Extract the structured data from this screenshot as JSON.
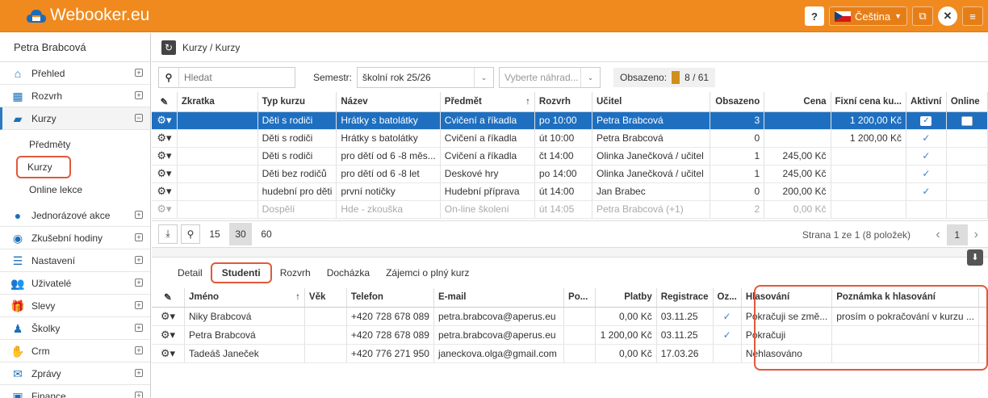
{
  "app": {
    "title": "Webooker.eu",
    "language": "Čeština"
  },
  "sidebar": {
    "user": "Petra Brabcová",
    "items": [
      {
        "label": "Přehled",
        "icon": "home-icon"
      },
      {
        "label": "Rozvrh",
        "icon": "calendar-icon"
      },
      {
        "label": "Kurzy",
        "icon": "book-icon"
      },
      {
        "label": "Jednorázové akce",
        "icon": "ball-icon"
      },
      {
        "label": "Zkušební hodiny",
        "icon": "eye-icon"
      },
      {
        "label": "Nastavení",
        "icon": "settings-icon"
      },
      {
        "label": "Uživatelé",
        "icon": "users-icon"
      },
      {
        "label": "Slevy",
        "icon": "gift-icon"
      },
      {
        "label": "Školky",
        "icon": "child-icon"
      },
      {
        "label": "Crm",
        "icon": "handshake-icon"
      },
      {
        "label": "Zprávy",
        "icon": "mail-icon"
      },
      {
        "label": "Finance",
        "icon": "money-icon"
      }
    ],
    "subitems": [
      "Předměty",
      "Kurzy",
      "Online lekce"
    ]
  },
  "breadcrumb": "Kurzy / Kurzy",
  "filter": {
    "search_placeholder": "Hledat",
    "semester_label": "Semestr:",
    "semester_value": "školní rok 25/26",
    "substitute_placeholder": "Vyberte náhrad...",
    "occupied_label": "Obsazeno:",
    "occupied_value": "8 / 61"
  },
  "courses": {
    "headers": [
      "Zkratka",
      "Typ kurzu",
      "Název",
      "Předmět",
      "Rozvrh",
      "Učitel",
      "Obsazeno",
      "Cena",
      "Fixní cena ku...",
      "Aktivní",
      "Online"
    ],
    "rows": [
      {
        "zkratka": "",
        "typ": "Děti s rodiči",
        "nazev": "Hrátky s batolátky",
        "predmet": "Cvičení a říkadla",
        "rozvrh": "po 10:00",
        "ucitel": "Petra Brabcová",
        "obsazeno": "3",
        "cena": "",
        "fixni": "1 200,00 Kč"
      },
      {
        "zkratka": "",
        "typ": "Děti s rodiči",
        "nazev": "Hrátky s batolátky",
        "predmet": "Cvičení a říkadla",
        "rozvrh": "út 10:00",
        "ucitel": "Petra Brabcová",
        "obsazeno": "0",
        "cena": "",
        "fixni": "1 200,00 Kč"
      },
      {
        "zkratka": "",
        "typ": "Děti s rodiči",
        "nazev": "pro dětí od 6 -8 měs...",
        "predmet": "Cvičení a říkadla",
        "rozvrh": "čt 14:00",
        "ucitel": "Olinka Janečková / učitel",
        "obsazeno": "1",
        "cena": "245,00 Kč",
        "fixni": ""
      },
      {
        "zkratka": "",
        "typ": "Děti bez rodičů",
        "nazev": "pro dětí od 6 -8 let",
        "predmet": "Deskové hry",
        "rozvrh": "po 14:00",
        "ucitel": "Olinka Janečková / učitel",
        "obsazeno": "1",
        "cena": "245,00 Kč",
        "fixni": ""
      },
      {
        "zkratka": "",
        "typ": "hudební pro děti",
        "nazev": "první notičky",
        "predmet": "Hudební příprava",
        "rozvrh": "út 14:00",
        "ucitel": "Jan Brabec",
        "obsazeno": "0",
        "cena": "200,00 Kč",
        "fixni": ""
      },
      {
        "zkratka": "",
        "typ": "Dospělí",
        "nazev": "Hde - zkouška",
        "predmet": "On-line školení",
        "rozvrh": "út 14:05",
        "ucitel": "Petra Brabcová (+1)",
        "obsazeno": "2",
        "cena": "0,00 Kč",
        "fixni": ""
      }
    ]
  },
  "pager": {
    "sizes": [
      "15",
      "30",
      "60"
    ],
    "status": "Strana 1 ze 1 (8 položek)",
    "current_page": "1"
  },
  "detail_tabs": [
    "Detail",
    "Studenti",
    "Rozvrh",
    "Docházka",
    "Zájemci o plný kurz"
  ],
  "students": {
    "headers": [
      "Jméno",
      "Věk",
      "Telefon",
      "E-mail",
      "Po...",
      "Platby",
      "Registrace",
      "Oz...",
      "Hlasování",
      "Poznámka k hlasování"
    ],
    "rows": [
      {
        "jmeno": "Niky Brabcová",
        "vek": "",
        "telefon": "+420 728 678 089",
        "email": "petra.brabcova@aperus.eu",
        "po": "",
        "platby": "0,00 Kč",
        "registrace": "03.11.25",
        "hlasovani": "Pokračuji se změ...",
        "poznamka": "prosím o pokračování v kurzu ..."
      },
      {
        "jmeno": "Petra Brabcová",
        "vek": "",
        "telefon": "+420 728 678 089",
        "email": "petra.brabcova@aperus.eu",
        "po": "",
        "platby": "1 200,00 Kč",
        "registrace": "03.11.25",
        "hlasovani": "Pokračuji",
        "poznamka": ""
      },
      {
        "jmeno": "Tadeáš Janeček",
        "vek": "",
        "telefon": "+420 776 271 950",
        "email": "janeckova.olga@gmail.com",
        "po": "",
        "platby": "0,00 Kč",
        "registrace": "17.03.26",
        "hlasovani": "Nehlasováno",
        "poznamka": ""
      }
    ]
  }
}
